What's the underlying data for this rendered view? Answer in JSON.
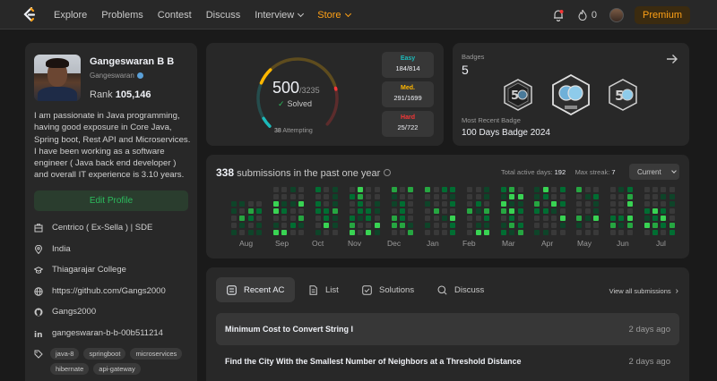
{
  "nav": {
    "links": [
      "Explore",
      "Problems",
      "Contest",
      "Discuss",
      "Interview",
      "Store"
    ],
    "streak": "0",
    "premium": "Premium"
  },
  "profile": {
    "name": "Gangeswaran B B",
    "username": "Gangeswaran",
    "rank_label": "Rank",
    "rank_value": "105,146",
    "bio": "I am passionate in Java programming, having good exposure in Core Java, Spring boot, Rest API and Microservices. I have been working as a software engineer ( Java back end developer ) and overall IT experience is 3.10 years.",
    "edit_label": "Edit Profile",
    "company": "Centrico ( Ex-Sella ) | SDE",
    "location": "India",
    "school": "Thiagarajar College",
    "website": "https://github.com/Gangs2000",
    "github": "Gangs2000",
    "linkedin": "gangeswaran-b-b-00b511214",
    "skills": [
      "java-8",
      "springboot",
      "microservices",
      "hibernate",
      "api-gateway"
    ]
  },
  "solved": {
    "count": "500",
    "total": "/3235",
    "label": "Solved",
    "attempting_count": "38",
    "attempting_label": "Attempting",
    "easy_label": "Easy",
    "easy_value": "184/814",
    "easy_solved": 184,
    "medium_label": "Med.",
    "medium_value": "291/1699",
    "medium_solved": 291,
    "hard_label": "Hard",
    "hard_value": "25/722",
    "hard_solved": 25,
    "colors": {
      "easy": "#1cbaba",
      "medium": "#ffb700",
      "hard": "#f63737"
    }
  },
  "badges": {
    "label": "Badges",
    "count": "5",
    "recent_label": "Most Recent Badge",
    "recent_name": "100 Days Badge 2024",
    "icons": [
      "50-days-badge-icon",
      "100-days-badge-icon",
      "50-days-badge-icon"
    ]
  },
  "submissions": {
    "count": "338",
    "label": "submissions in the past one year",
    "active_days_label": "Total active days:",
    "active_days": "192",
    "max_streak_label": "Max streak:",
    "max_streak": "7",
    "period": "Current",
    "months": [
      "Aug",
      "Sep",
      "Oct",
      "Nov",
      "Dec",
      "Jan",
      "Feb",
      "Mar",
      "Apr",
      "May",
      "Jun",
      "Jul"
    ]
  },
  "recent": {
    "tabs": [
      "Recent AC",
      "List",
      "Solutions",
      "Discuss"
    ],
    "view_all": "View all submissions",
    "items": [
      {
        "title": "Minimum Cost to Convert String I",
        "ago": "2 days ago"
      },
      {
        "title": "Find the City With the Smallest Number of Neighbors at a Threshold Distance",
        "ago": "2 days ago"
      }
    ]
  }
}
